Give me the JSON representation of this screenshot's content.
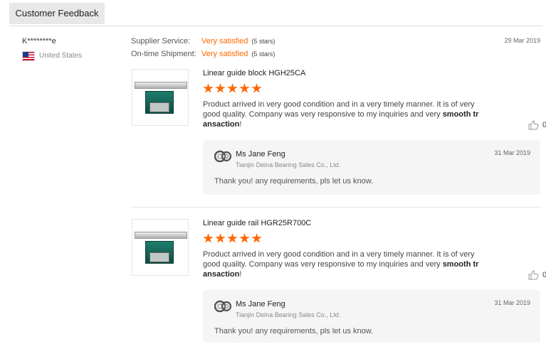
{
  "tab": {
    "label": "Customer Feedback"
  },
  "buyer": {
    "name": "K********e",
    "country": "United States",
    "flag": "us-flag-icon"
  },
  "ratings": [
    {
      "label": "Supplier Service:",
      "value": "Very satisfied",
      "stars": "(5 stars)"
    },
    {
      "label": "On-time Shipment:",
      "value": "Very satisfied",
      "stars": "(5 stars)"
    }
  ],
  "review_date": "29 Mar 2019",
  "accent_color": "#ff6600",
  "reviews": [
    {
      "product": "Linear guide block HGH25CA",
      "rating": 5,
      "text": "Product arrived in very good condition and in a very timely manner.  It is of very good quality.  Company was very responsive to my inquiries and very ",
      "text_bold": "smooth transaction",
      "text_end": "!",
      "likes": "0",
      "reply": {
        "name": "Ms Jane Feng",
        "company": "Tianjin Deina Bearing Sales Co., Ltd.",
        "date": "31 Mar 2019",
        "text": "Thank you! any  requirements, pls let us know."
      }
    },
    {
      "product": "Linear guide rail HGR25R700C",
      "rating": 5,
      "text": "Product arrived in very good condition and in a very timely manner.  It is of very good quality.  Company was very responsive to my inquiries and very ",
      "text_bold": "smooth transaction",
      "text_end": "!",
      "likes": "0",
      "reply": {
        "name": "Ms Jane Feng",
        "company": "Tianjin Deina Bearing Sales Co., Ltd.",
        "date": "31 Mar 2019",
        "text": "Thank you! any  requirements, pls let us know."
      }
    }
  ]
}
